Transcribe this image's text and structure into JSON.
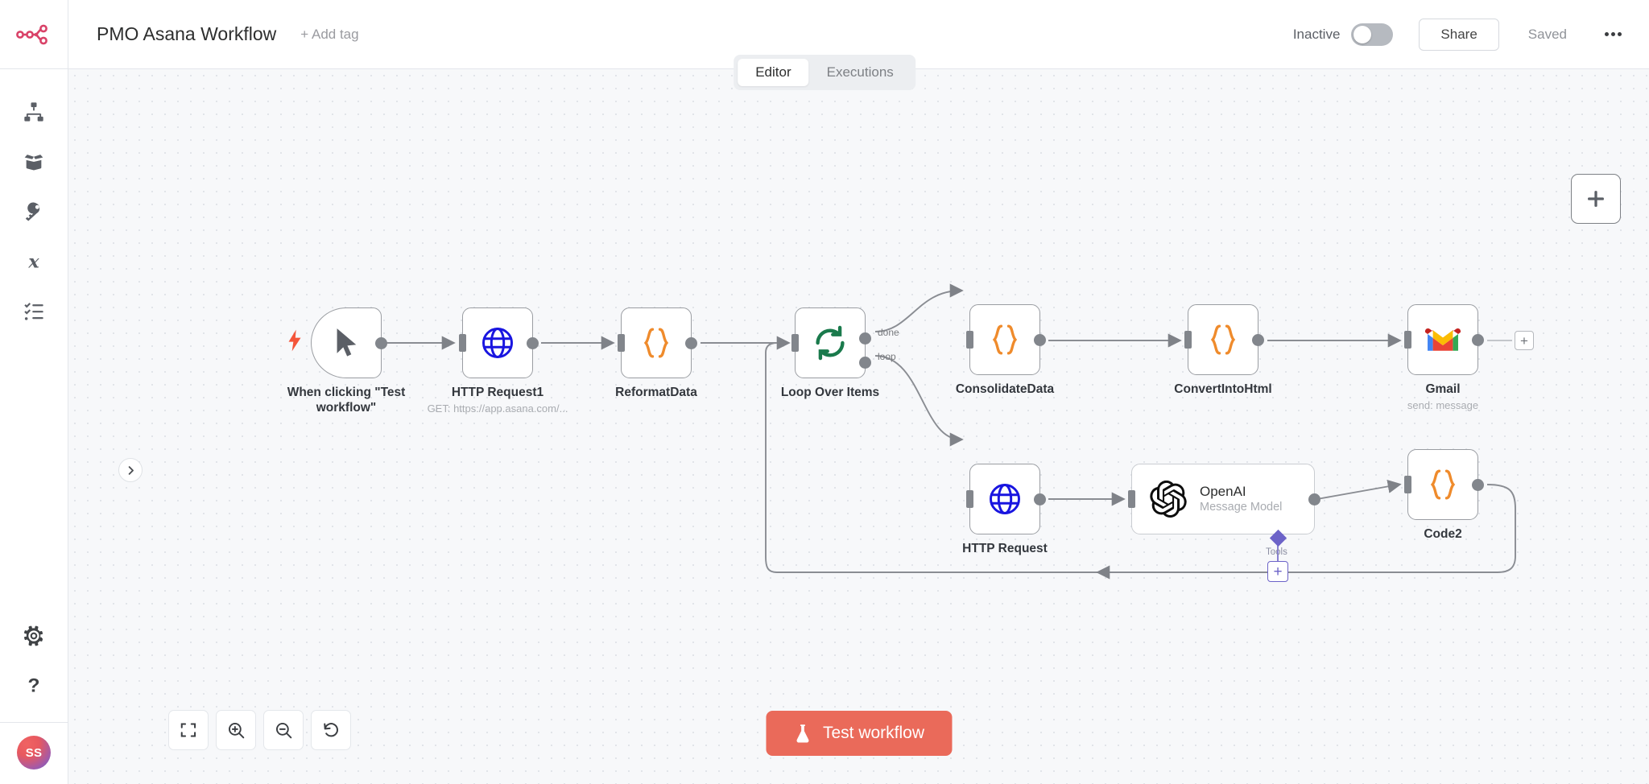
{
  "header": {
    "logo": "n8n-logo-icon",
    "workflow_title": "PMO Asana Workflow",
    "add_tag_label": "+ Add tag",
    "active_state_label": "Inactive",
    "share_label": "Share",
    "saved_label": "Saved",
    "more_options": "ellipsis-icon"
  },
  "tabs": [
    {
      "label": "Editor",
      "active": true
    },
    {
      "label": "Executions",
      "active": false
    }
  ],
  "sidebar": {
    "items": [
      {
        "name": "overview",
        "icon": "sitemap-icon"
      },
      {
        "name": "templates",
        "icon": "box-open-icon"
      },
      {
        "name": "credentials",
        "icon": "key-icon"
      },
      {
        "name": "variables",
        "icon": "variable-x-icon"
      },
      {
        "name": "executions",
        "icon": "checklist-icon"
      }
    ],
    "bottom_items": [
      {
        "name": "settings",
        "icon": "gear-icon"
      },
      {
        "name": "help",
        "icon": "question-mark-icon"
      }
    ],
    "avatar_initials": "SS",
    "expand_icon": "chevron-right-icon"
  },
  "canvas": {
    "add_node_icon": "plus-icon",
    "zoom_controls": [
      {
        "name": "zoom-to-fit",
        "icon": "fit-screen-icon"
      },
      {
        "name": "zoom-in",
        "icon": "magnifier-plus-icon"
      },
      {
        "name": "zoom-out",
        "icon": "magnifier-minus-icon"
      },
      {
        "name": "reset-zoom",
        "icon": "undo-icon"
      }
    ],
    "test_workflow_label": "Test workflow",
    "test_workflow_icon": "flask-icon",
    "accent_color": "#ea6a5a"
  },
  "nodes": [
    {
      "id": "trigger",
      "label": "When clicking \"Test workflow\"",
      "subtitle": "",
      "icon": "mouse-pointer-icon",
      "type": "trigger"
    },
    {
      "id": "http_request1",
      "label": "HTTP Request1",
      "subtitle": "GET: https://app.asana.com/...",
      "icon": "globe-icon",
      "type": "action"
    },
    {
      "id": "reformat_data",
      "label": "ReformatData",
      "subtitle": "",
      "icon": "code-braces-icon",
      "type": "action"
    },
    {
      "id": "loop_over_items",
      "label": "Loop Over Items",
      "subtitle": "",
      "icon": "loop-refresh-icon",
      "type": "loop",
      "outputs": [
        "done",
        "loop"
      ]
    },
    {
      "id": "consolidate_data",
      "label": "ConsolidateData",
      "subtitle": "",
      "icon": "code-braces-icon",
      "type": "action"
    },
    {
      "id": "convert_into_html",
      "label": "ConvertIntoHtml",
      "subtitle": "",
      "icon": "code-braces-icon",
      "type": "action"
    },
    {
      "id": "gmail",
      "label": "Gmail",
      "subtitle": "send: message",
      "icon": "gmail-icon",
      "type": "action"
    },
    {
      "id": "http_request",
      "label": "HTTP Request",
      "subtitle": "",
      "icon": "globe-icon",
      "type": "action"
    },
    {
      "id": "openai",
      "label": "OpenAI",
      "subtitle": "Message Model",
      "icon": "openai-icon",
      "type": "ai",
      "sub_connector_label": "Tools"
    },
    {
      "id": "code2",
      "label": "Code2",
      "subtitle": "",
      "icon": "code-braces-icon",
      "type": "action"
    }
  ]
}
